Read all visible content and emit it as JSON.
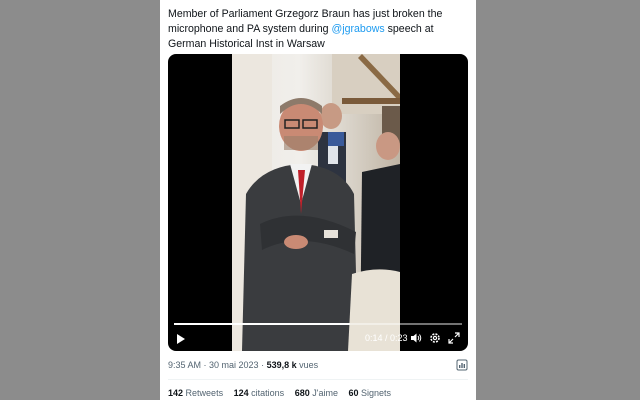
{
  "tweet": {
    "text_before": "Member of Parliament Grzegorz Braun has just broken the microphone and PA system during ",
    "mention": "@jgrabows",
    "text_after": " speech at German Historical Inst in Warsaw"
  },
  "video": {
    "current_time": "0:14",
    "separator": " / ",
    "duration": "0:23",
    "progress": 0.61
  },
  "meta": {
    "time": "9:35 AM",
    "dot1": " · ",
    "date": "30 mai 2023",
    "dot2": " · ",
    "views_count": "539,8 k",
    "views_label": "vues"
  },
  "stats": {
    "retweets_count": "142",
    "retweets_label": "Retweets",
    "quotes_count": "124",
    "quotes_label": "citations",
    "likes_count": "680",
    "likes_label": "J'aime",
    "bookmarks_count": "60",
    "bookmarks_label": "Signets"
  },
  "colors": {
    "page_background": "#8c8c8c",
    "card_background": "#ffffff",
    "mention_color": "#1d9bf0",
    "secondary_text": "#536471"
  },
  "icons": [
    "play-icon",
    "volume-icon",
    "settings-gear-icon",
    "fullscreen-icon",
    "analytics-icon"
  ]
}
